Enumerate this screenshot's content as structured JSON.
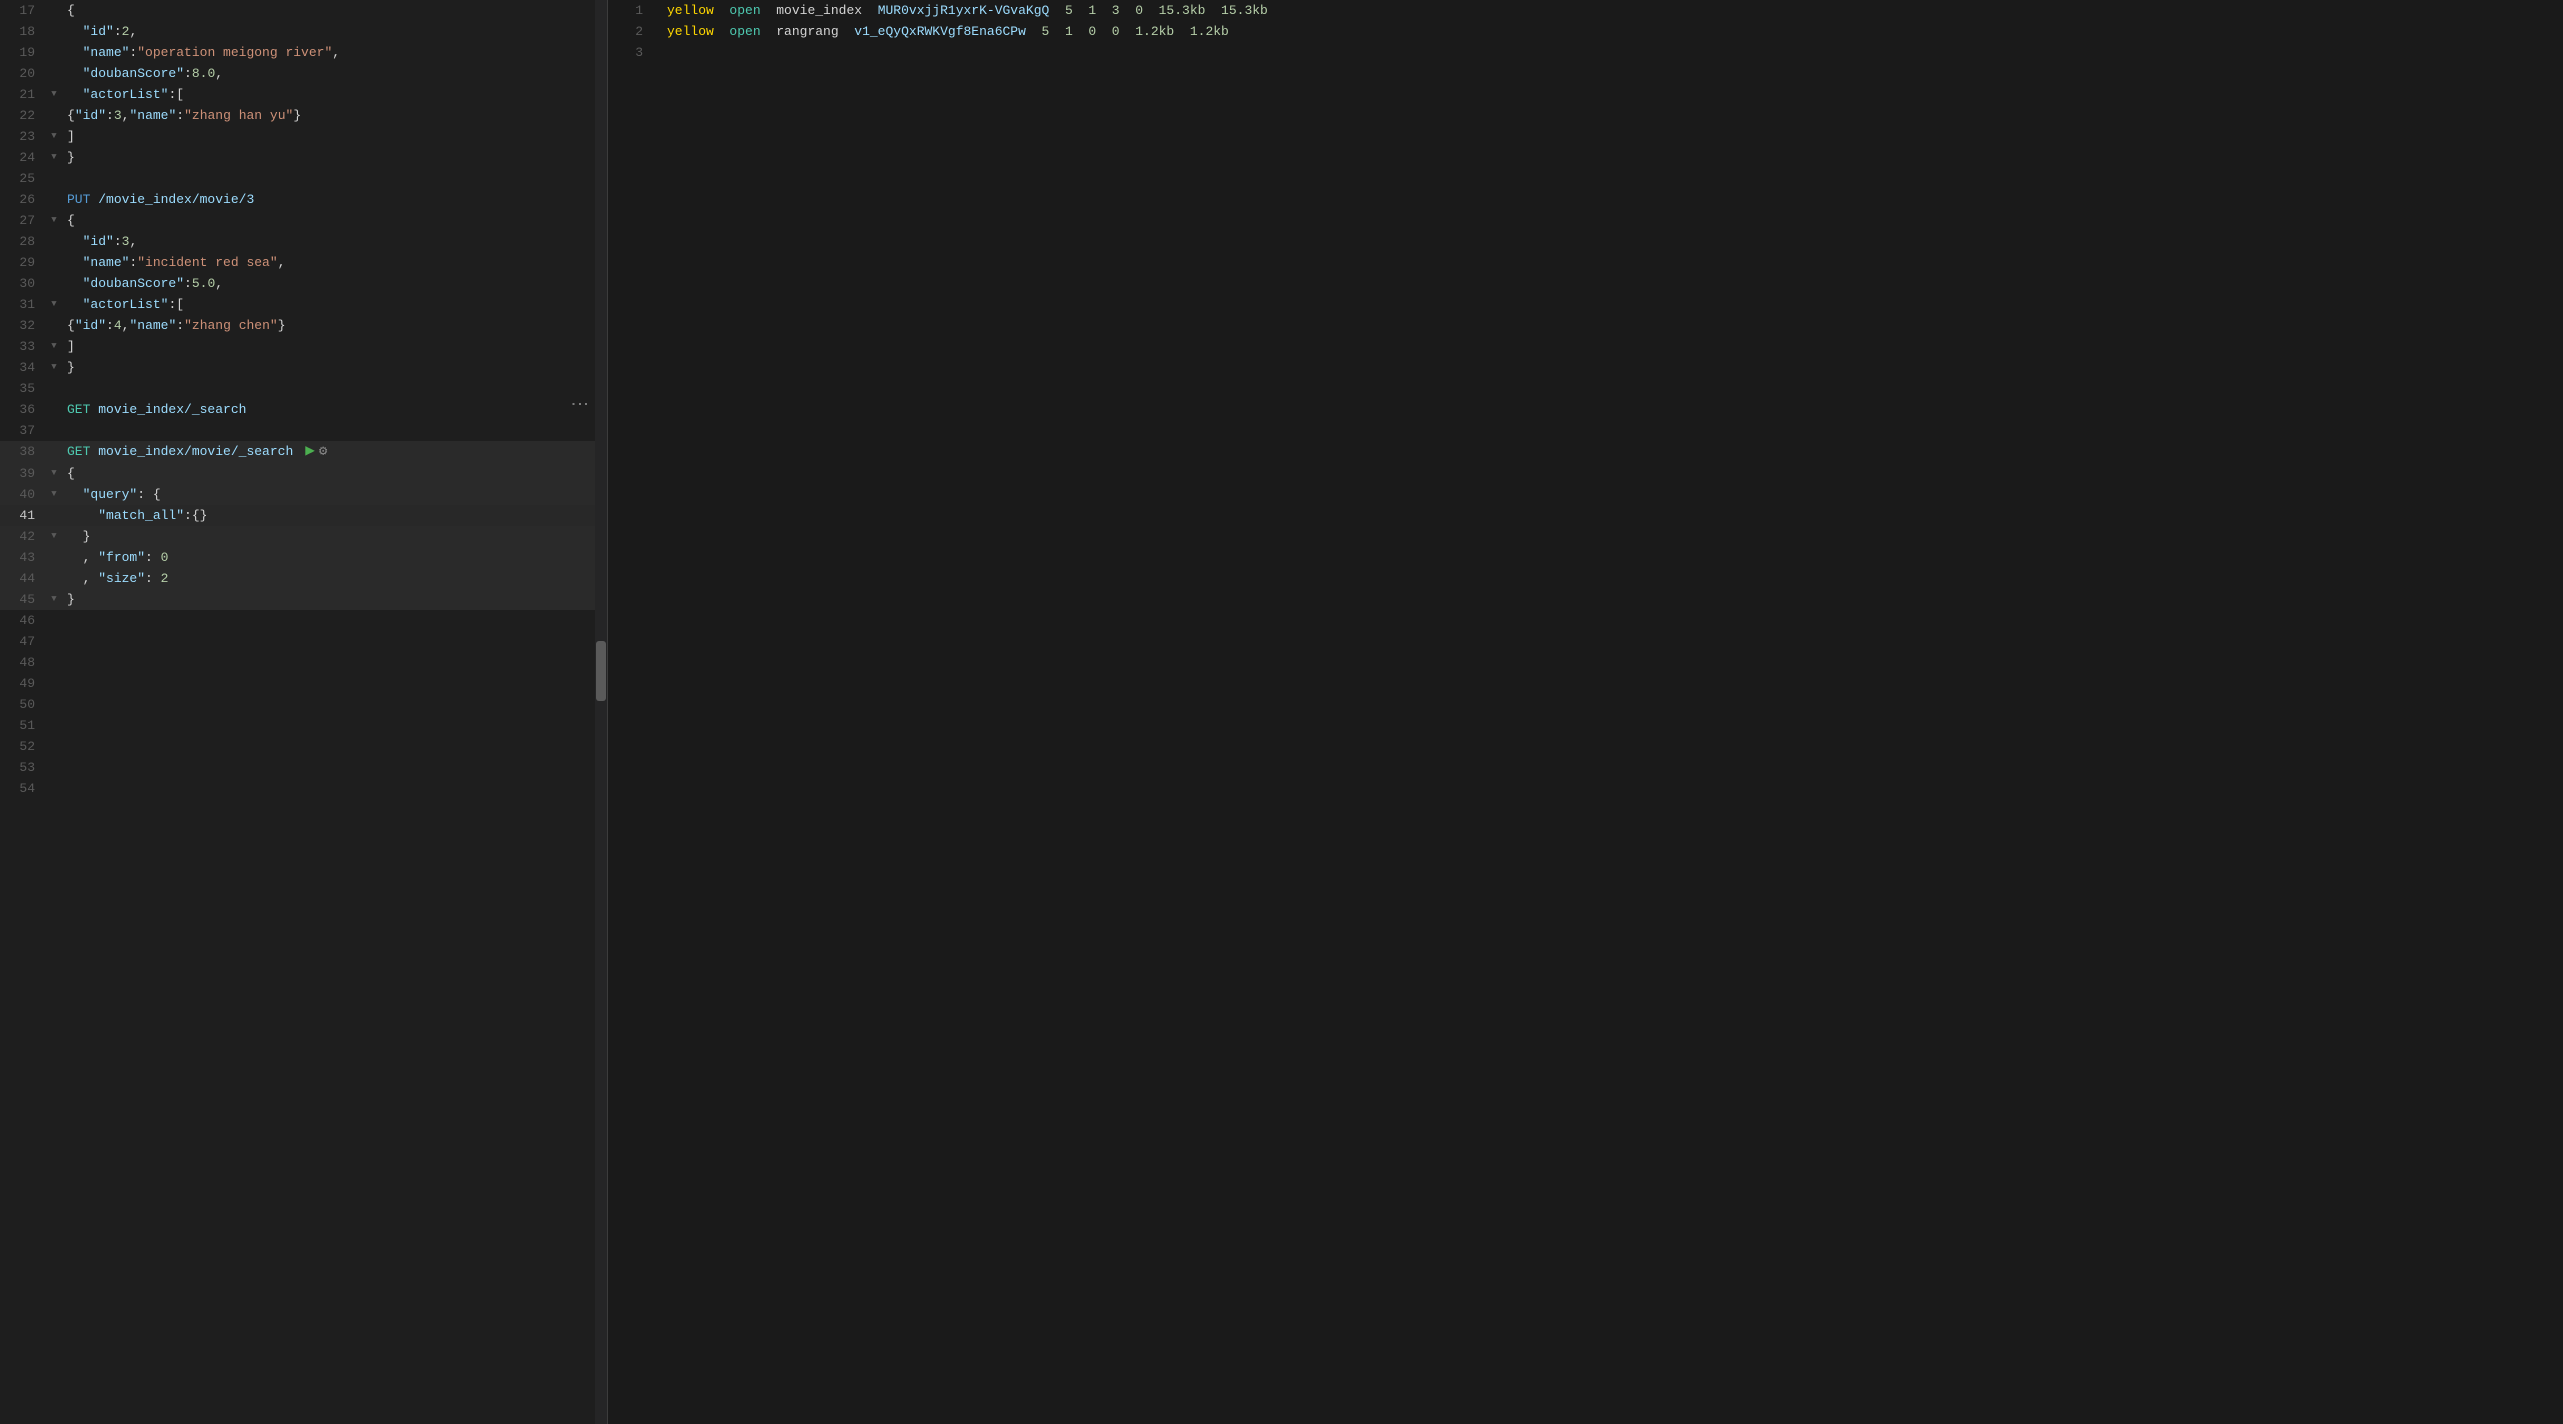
{
  "editor": {
    "lines": [
      {
        "num": 17,
        "gutter": "",
        "content": "{",
        "type": "plain"
      },
      {
        "num": 18,
        "gutter": "",
        "content": "  \"id\":2,",
        "type": "id"
      },
      {
        "num": 19,
        "gutter": "",
        "content": "  \"name\":\"operation meigong river\",",
        "type": "name"
      },
      {
        "num": 20,
        "gutter": "",
        "content": "  \"doubanScore\":8.0,",
        "type": "score"
      },
      {
        "num": 21,
        "gutter": "▼",
        "content": "  \"actorList\":[",
        "type": "actorList"
      },
      {
        "num": 22,
        "gutter": "",
        "content": "{\"id\":3,\"name\":\"zhang han yu\"}",
        "type": "actor"
      },
      {
        "num": 23,
        "gutter": "▼",
        "content": "]",
        "type": "plain"
      },
      {
        "num": 24,
        "gutter": "▼",
        "content": "}",
        "type": "plain"
      },
      {
        "num": 25,
        "gutter": "",
        "content": "",
        "type": "empty"
      },
      {
        "num": 26,
        "gutter": "",
        "content": "PUT /movie_index/movie/3",
        "type": "put"
      },
      {
        "num": 27,
        "gutter": "▼",
        "content": "{",
        "type": "plain"
      },
      {
        "num": 28,
        "gutter": "",
        "content": "  \"id\":3,",
        "type": "id"
      },
      {
        "num": 29,
        "gutter": "",
        "content": "  \"name\":\"incident red sea\",",
        "type": "name"
      },
      {
        "num": 30,
        "gutter": "",
        "content": "  \"doubanScore\":5.0,",
        "type": "score"
      },
      {
        "num": 31,
        "gutter": "▼",
        "content": "  \"actorList\":[",
        "type": "actorList"
      },
      {
        "num": 32,
        "gutter": "",
        "content": "{\"id\":4,\"name\":\"zhang chen\"}",
        "type": "actor"
      },
      {
        "num": 33,
        "gutter": "▼",
        "content": "]",
        "type": "plain"
      },
      {
        "num": 34,
        "gutter": "▼",
        "content": "}",
        "type": "plain"
      },
      {
        "num": 35,
        "gutter": "",
        "content": "",
        "type": "empty"
      },
      {
        "num": 36,
        "gutter": "",
        "content": "GET movie_index/_search",
        "type": "get"
      },
      {
        "num": 37,
        "gutter": "",
        "content": "",
        "type": "empty"
      },
      {
        "num": 38,
        "gutter": "",
        "content": "GET movie_index/movie/_search",
        "type": "get-active",
        "hasPlay": true
      },
      {
        "num": 39,
        "gutter": "▼",
        "content": "{",
        "type": "plain"
      },
      {
        "num": 40,
        "gutter": "▼",
        "content": "  \"query\": {",
        "type": "query"
      },
      {
        "num": 41,
        "gutter": "",
        "content": "    \"match_all\":{}",
        "type": "match_all",
        "active": true
      },
      {
        "num": 42,
        "gutter": "▼",
        "content": "  }",
        "type": "plain"
      },
      {
        "num": 43,
        "gutter": "",
        "content": "  , \"from\": 0",
        "type": "from"
      },
      {
        "num": 44,
        "gutter": "",
        "content": "  , \"size\": 2",
        "type": "size"
      },
      {
        "num": 45,
        "gutter": "▼",
        "content": "}",
        "type": "plain"
      },
      {
        "num": 46,
        "gutter": "",
        "content": "",
        "type": "empty"
      },
      {
        "num": 47,
        "gutter": "",
        "content": "",
        "type": "empty"
      },
      {
        "num": 48,
        "gutter": "",
        "content": "",
        "type": "empty"
      },
      {
        "num": 49,
        "gutter": "",
        "content": "",
        "type": "empty"
      },
      {
        "num": 50,
        "gutter": "",
        "content": "",
        "type": "empty"
      },
      {
        "num": 51,
        "gutter": "",
        "content": "",
        "type": "empty"
      },
      {
        "num": 52,
        "gutter": "",
        "content": "",
        "type": "empty"
      },
      {
        "num": 53,
        "gutter": "",
        "content": "",
        "type": "empty"
      },
      {
        "num": 54,
        "gutter": "",
        "content": "",
        "type": "empty"
      }
    ]
  },
  "result": {
    "lines": [
      {
        "num": 1,
        "content": "yellow open  movie_index  MUR0vxjjR1yxrK-VGvaKgQ  5  1  3  0  15.3kb  15.3kb"
      },
      {
        "num": 2,
        "content": "yellow open  rangrang     v1_eQyQxRWKVgf8Ena6CPw  5  1  0  0   1.2kb   1.2kb"
      },
      {
        "num": 3,
        "content": ""
      }
    ]
  }
}
